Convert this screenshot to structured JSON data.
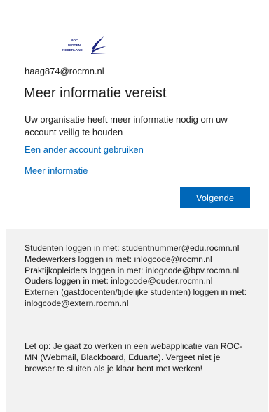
{
  "org": {
    "logo_icon": "roc-midden-nederland-logo",
    "logo_lines": [
      "ROC",
      "MIDDEN",
      "NEDERLAND"
    ],
    "brand_color": "#1a237e",
    "accent_color": "#0067b8"
  },
  "account": {
    "email": "haag874@rocmn.nl"
  },
  "main": {
    "title": "Meer informatie vereist",
    "description": "Uw organisatie heeft meer informatie nodig om uw account veilig te houden",
    "other_account_link": "Een ander account gebruiken",
    "more_info_link": "Meer informatie",
    "next_button": "Volgende"
  },
  "footer": {
    "login_info": "Studenten loggen in met: studentnummer@edu.rocmn.nl Medewerkers loggen in met: inlogcode@rocmn.nl Praktijkopleiders loggen in met: inlogcode@bpv.rocmn.nl Ouders loggen in met: inlogcode@ouder.rocmn.nl Externen (gastdocenten/tijdelijke studenten) loggen in met: inlogcode@extern.rocmn.nl",
    "notice": "Let op: Je gaat zo werken in een webapplicatie van ROC-MN (Webmail, Blackboard, Eduarte). Vergeet niet je browser te sluiten als je klaar bent met werken!"
  }
}
